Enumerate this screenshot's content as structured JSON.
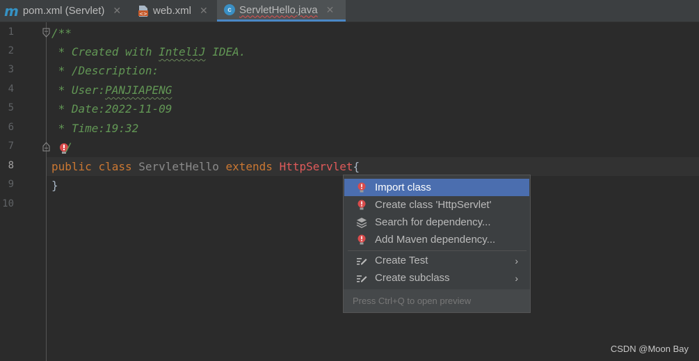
{
  "tabs": [
    {
      "label": "pom.xml (Servlet)",
      "icon": "maven-icon",
      "close": "✕"
    },
    {
      "label": "web.xml",
      "icon": "xml-file-icon",
      "close": "✕"
    },
    {
      "label": "ServletHello.java",
      "icon": "java-class-icon",
      "close": "✕",
      "active": true
    }
  ],
  "gutter": {
    "line_numbers": [
      "1",
      "2",
      "3",
      "4",
      "5",
      "6",
      "7",
      "8",
      "9",
      "10"
    ],
    "current_line": "8"
  },
  "code": {
    "l1": "/**",
    "l2_a": " * Created with ",
    "l2_b": "InteliJ",
    "l2_c": " IDEA.",
    "l3": " * /Description:",
    "l4_a": " * User:",
    "l4_b": "PANJIAPENG",
    "l5": " * Date:2022-11-09",
    "l6": " * Time:19:32",
    "l7": "/",
    "l8_kw1": "public",
    "l8_kw2": "class",
    "l8_cls": "ServletHello",
    "l8_kw3": "extends",
    "l8_err": "HttpServlet",
    "l8_brace": "{",
    "l9": "}"
  },
  "popup": {
    "items": [
      {
        "label": "Import class",
        "icon": "red-bulb-icon",
        "selected": true
      },
      {
        "label": "Create class 'HttpServlet'",
        "icon": "red-bulb-icon"
      },
      {
        "label": "Search for dependency...",
        "icon": "layers-icon"
      },
      {
        "label": "Add Maven dependency...",
        "icon": "red-bulb-icon"
      },
      {
        "label": "Create Test",
        "icon": "edit-intention-icon",
        "submenu": "›"
      },
      {
        "label": "Create subclass",
        "icon": "edit-intention-icon",
        "submenu": "›"
      }
    ],
    "footer": "Press Ctrl+Q to open preview"
  },
  "watermark": "CSDN @Moon Bay",
  "colors": {
    "accent": "#4b6eaf",
    "error": "#e05a5a",
    "keyword": "#cc7832",
    "comment": "#629755"
  }
}
